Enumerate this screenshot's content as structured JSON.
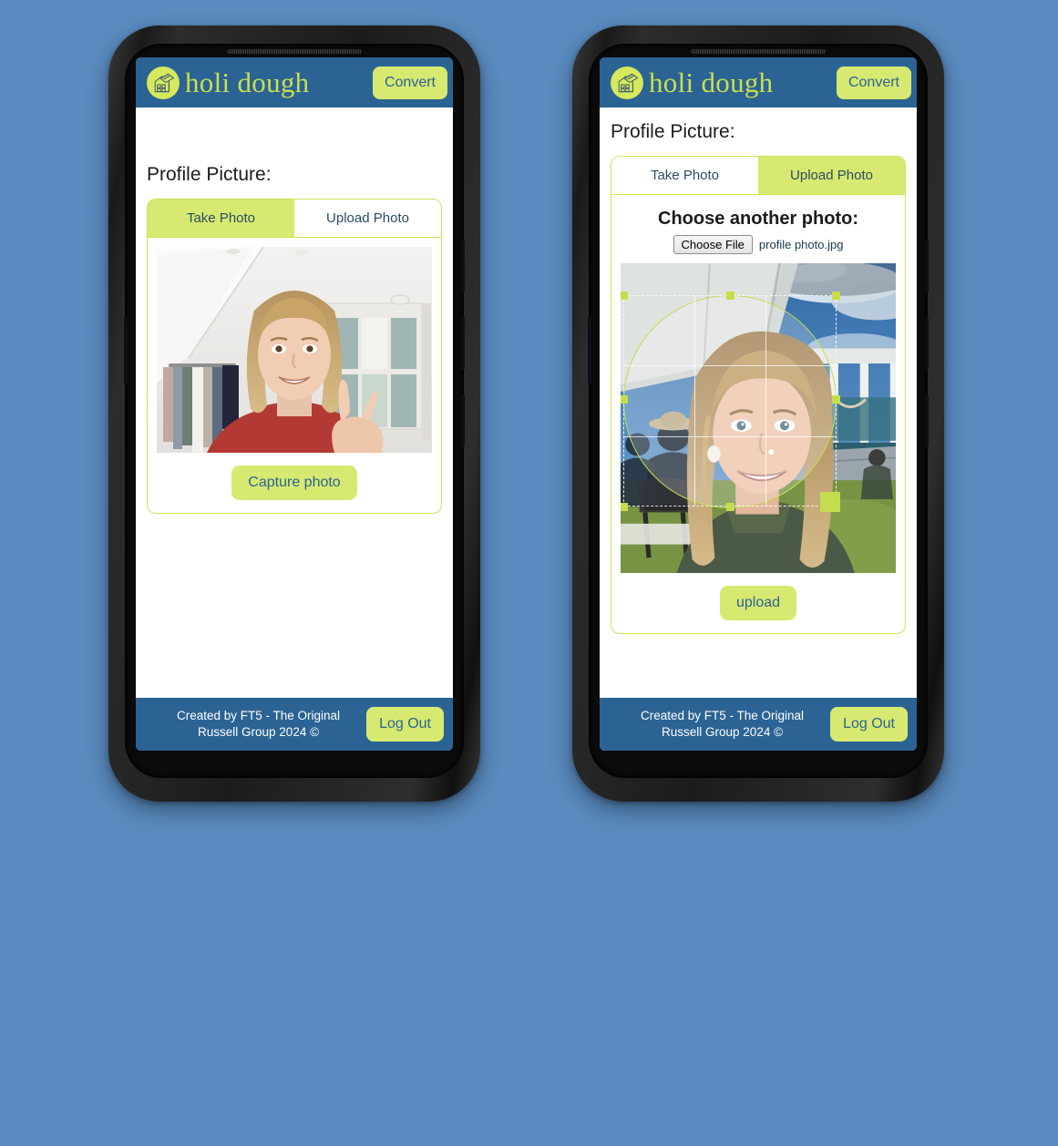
{
  "page": {
    "background_color": "#5a8cc1",
    "device_count": 2
  },
  "theme": {
    "header_blue": "#2b6394",
    "accent_lime": "#d7e970",
    "brand_text": "#c8e04e",
    "button_text": "#2b6394",
    "card_border": "#cfe356"
  },
  "header": {
    "logo_icon": "house-logo-icon",
    "brand": "holi dough",
    "convert_label": "Convert"
  },
  "footer": {
    "credit": "Created by FT5 - The Original\nRussell Group 2024 ©",
    "logout_label": "Log Out"
  },
  "screens": [
    {
      "id": "take-photo-screen",
      "page_title": "Profile Picture:",
      "tabs": [
        {
          "label": "Take Photo",
          "active": true
        },
        {
          "label": "Upload Photo",
          "active": false
        }
      ],
      "camera": {
        "alt": "Live webcam preview of a smiling blonde woman making a peace sign in a bright attic bedroom with a clothes rail and wardrobe"
      },
      "action_label": "Capture photo"
    },
    {
      "id": "upload-photo-screen",
      "page_title": "Profile Picture:",
      "tabs": [
        {
          "label": "Take Photo",
          "active": false
        },
        {
          "label": "Upload Photo",
          "active": true
        }
      ],
      "upload": {
        "heading": "Choose another photo:",
        "file_button_label": "Choose File",
        "file_name": "profile photo.jpg"
      },
      "crop": {
        "alt": "Outdoor photo of a smiling blonde woman in a green jumper under a white marquee, with circular crop overlay",
        "shape": "circle",
        "handle_color": "#c4dd4e",
        "guides": "rule-of-thirds"
      },
      "action_label": "upload"
    }
  ]
}
